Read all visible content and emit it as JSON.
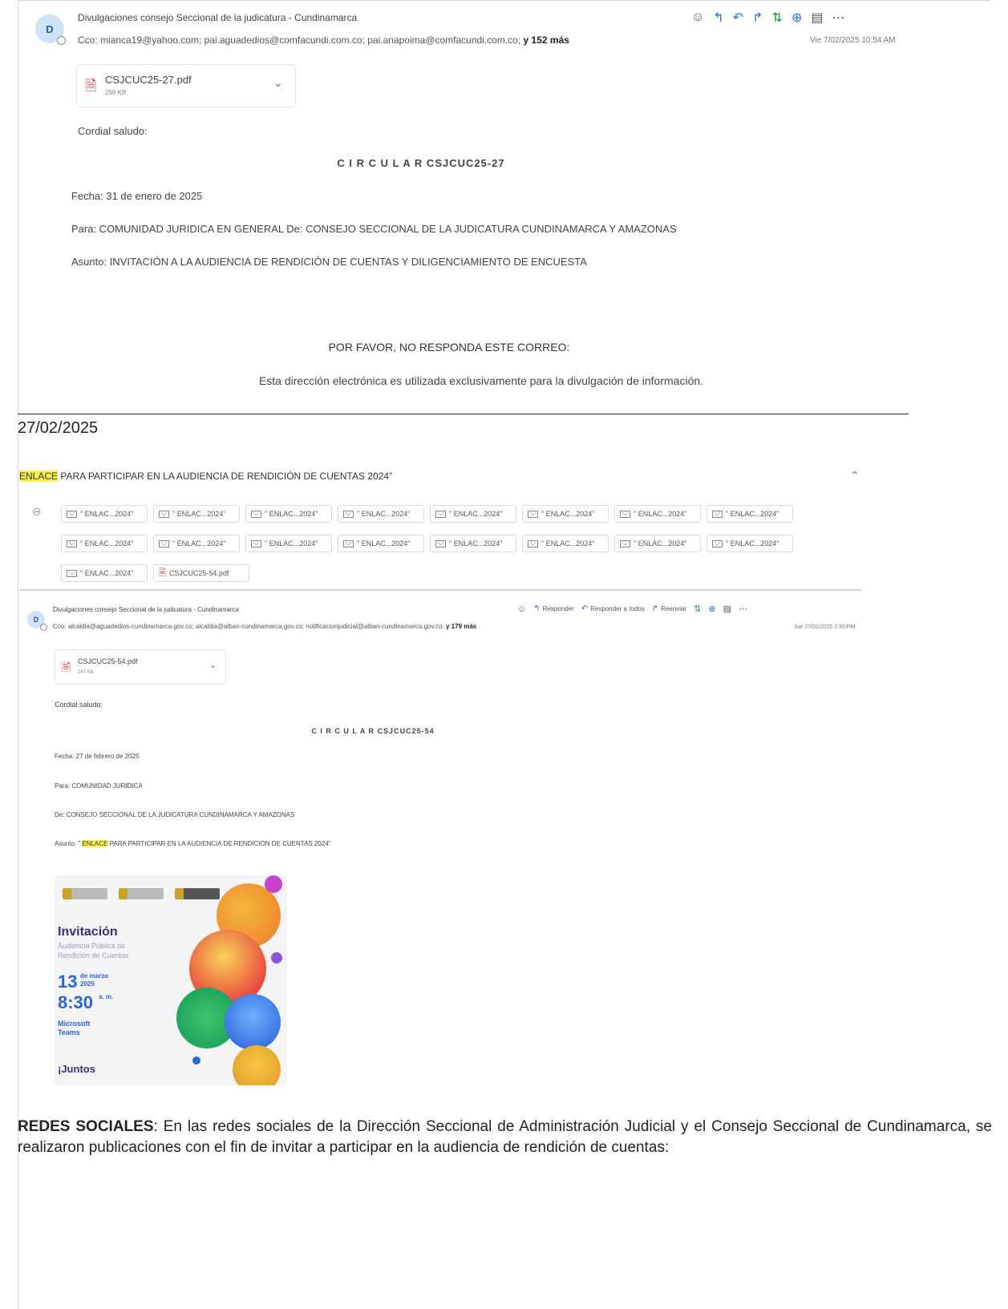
{
  "email1": {
    "avatar": "D",
    "sender": "Divulgaciones consejo Seccional de la judicatura - Cundinamarca",
    "cc_label": "Cco:",
    "cc_list": "mianca19@yahoo.com;  pai.aguadedios@comfacundi.com.co;  pai.anapoima@comfacundi.com.co;",
    "cc_more": "y 152 más",
    "date": "Vie 7/02/2025 10:54 AM",
    "attachment": {
      "name": "CSJCUC25-27.pdf",
      "size": "298 KB"
    },
    "greeting": "Cordial saludo:",
    "circular_title": "C I R C U L A R CSJCUC25-27",
    "fecha": "Fecha: 31 de enero de 2025",
    "para": "Para: COMUNIDAD JURIDICA EN GENERAL De: CONSEJO SECCIONAL DE LA JUDICATURA CUNDINAMARCA Y AMAZONAS",
    "asunto": "Asunto: INVITACIÓN A LA AUDIENCIA DE RENDICIÓN DE CUENTAS Y DILIGENCIAMIENTO DE ENCUESTA",
    "no_reply": "POR FAVOR, NO RESPONDA ESTE CORREO:",
    "disclaimer": "Esta dirección electrónica es utilizada exclusivamente para la divulgación de información."
  },
  "doc_date": "27/02/2025",
  "email2": {
    "subject_highlight": "ENLACE",
    "subject_rest": " PARA PARTICIPAR EN LA AUDIENCIA DE RENDICIÓN DE CUENTAS 2024\"",
    "chip_label": "\" ENLAC...2024\"",
    "pdf_chip": "CSJCUC25-54.pdf",
    "avatar": "D",
    "sender": "Divulgaciones consejo Seccional de la judicatura - Cundinamarca",
    "cc_label": "Cco:",
    "cc_list": "alcaldia@aguadedios-cundinamarca.gov.co;  alcaldia@alban-cundinamarca.gov.co;  notificacionjudicial@alban-cundinamarca.gov.co;",
    "cc_more": "y 179 más",
    "reply": "Responder",
    "reply_all": "Responder a todos",
    "forward": "Reenviar",
    "date": "Jue 27/02/2025 2:30 PM",
    "attachment": {
      "name": "CSJCUC25-54.pdf",
      "size": "247 KB"
    },
    "greeting": "Cordial saludo:",
    "circular_title": "C I R C U L A R CSJCUC25-54",
    "fecha": "Fecha: 27 de febrero de 2025",
    "para": "Para: COMUNIDAD JURÍDICA",
    "de": "De: CONSEJO SECCIONAL DE LA JUDICATURA CUNDINAMARCA Y AMAZONAS",
    "asunto_prefix": "Asunto: \" ",
    "asunto_highlight": "ENLACE",
    "asunto_rest": " PARA PARTICIPAR EN LA AUDIENCIA DE RENDICIÓN DE CUENTAS 2024\""
  },
  "poster": {
    "title": "Invitación",
    "subtitle1": "Audiencia Pública de",
    "subtitle2": "Rendición de Cuentas",
    "day": "13",
    "month": "de marzo",
    "year": "2025",
    "time": "8:30",
    "ampm": "a. m.",
    "platform1": "Microsoft",
    "platform2": "Teams",
    "slogan": "¡Juntos"
  },
  "redes": {
    "label": "REDES SOCIALES",
    "text": ": En las redes sociales de la Dirección Seccional de Administración Judicial y el Consejo Seccional de Cundinamarca, se realizaron publicaciones con el fin de invitar a participar en la audiencia de rendición de cuentas:"
  }
}
